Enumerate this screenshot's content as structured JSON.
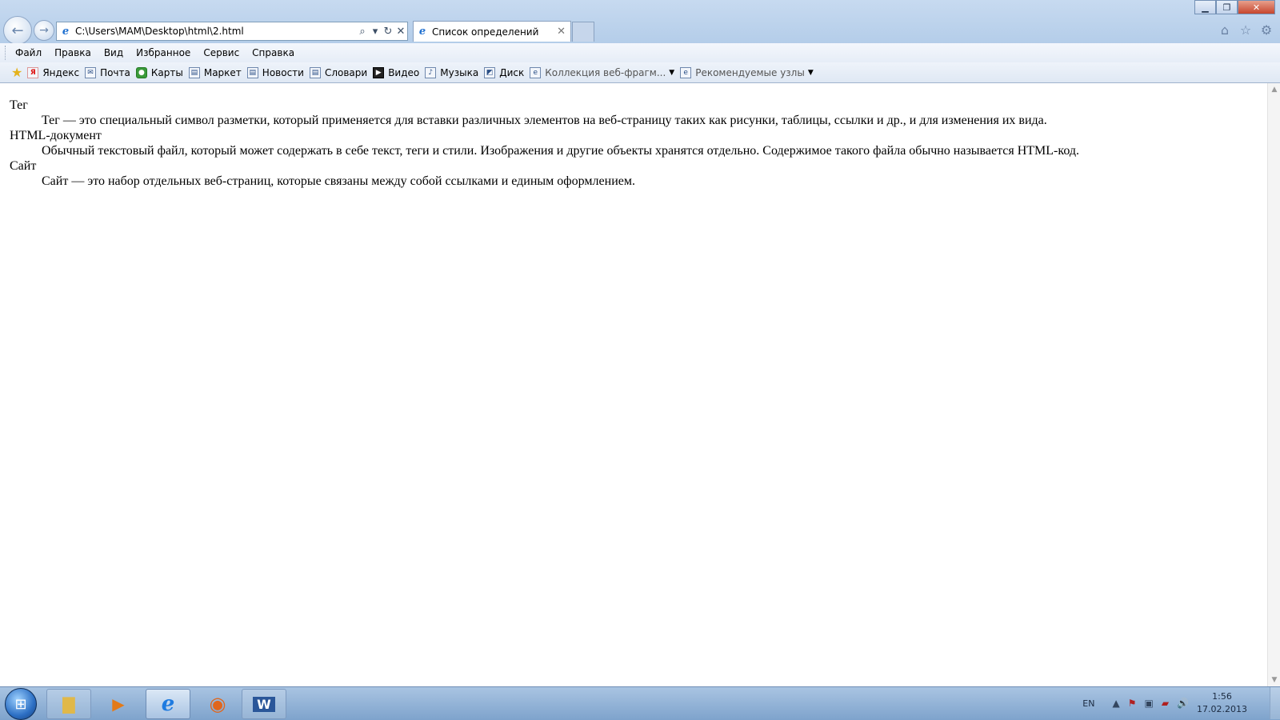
{
  "browser": {
    "address": "C:\\Users\\MAM\\Desktop\\html\\2.html",
    "tab_title": "Список определений",
    "tab_close": "✕",
    "window_controls": {
      "minimize": "▁",
      "restore": "❐",
      "close": "✕"
    },
    "nav": {
      "back": "←",
      "forward": "→"
    },
    "address_controls": {
      "search": "⌕",
      "dropdown": "▾",
      "refresh": "↻",
      "stop": "✕"
    },
    "right_icons": [
      "home-icon",
      "favorites-star-icon",
      "tools-gear-icon"
    ]
  },
  "menu": [
    "Файл",
    "Правка",
    "Вид",
    "Избранное",
    "Сервис",
    "Справка"
  ],
  "favorites": [
    {
      "label": "Яндекс",
      "icon": "Я",
      "kind": "ya"
    },
    {
      "label": "Почта",
      "icon": "✉",
      "kind": "page"
    },
    {
      "label": "Карты",
      "icon": "●",
      "kind": "maps"
    },
    {
      "label": "Маркет",
      "icon": "▤",
      "kind": "page"
    },
    {
      "label": "Новости",
      "icon": "▤",
      "kind": "page"
    },
    {
      "label": "Словари",
      "icon": "▤",
      "kind": "page"
    },
    {
      "label": "Видео",
      "icon": "▶",
      "kind": "video"
    },
    {
      "label": "Музыка",
      "icon": "♪",
      "kind": "page"
    },
    {
      "label": "Диск",
      "icon": "◩",
      "kind": "page"
    },
    {
      "label": "Коллекция веб-фрагм...",
      "icon": "e",
      "kind": "page",
      "dropdown": true
    },
    {
      "label": "Рекомендуемые узлы",
      "icon": "e",
      "kind": "page",
      "dropdown": true
    }
  ],
  "content": {
    "definitions": [
      {
        "term": "Тег",
        "definition": "Тег — это специальный символ разметки, который применяется для вставки различных элементов на веб-страницу таких как рисунки, таблицы, ссылки и др., и для изменения их вида."
      },
      {
        "term": "HTML-документ",
        "definition": "Обычный текстовый файл, который может содержать в себе текст, теги и стили. Изображения и другие объекты хранятся отдельно. Содержимое такого файла обычно называется HTML-код."
      },
      {
        "term": "Сайт",
        "definition": "Сайт — это набор отдельных веб-страниц, которые связаны между собой ссылками и единым оформлением."
      }
    ]
  },
  "taskbar": {
    "apps": [
      "windows-explorer",
      "media-player",
      "internet-explorer",
      "firefox",
      "word"
    ],
    "language": "EN",
    "time": "1:56",
    "date": "17.02.2013"
  }
}
